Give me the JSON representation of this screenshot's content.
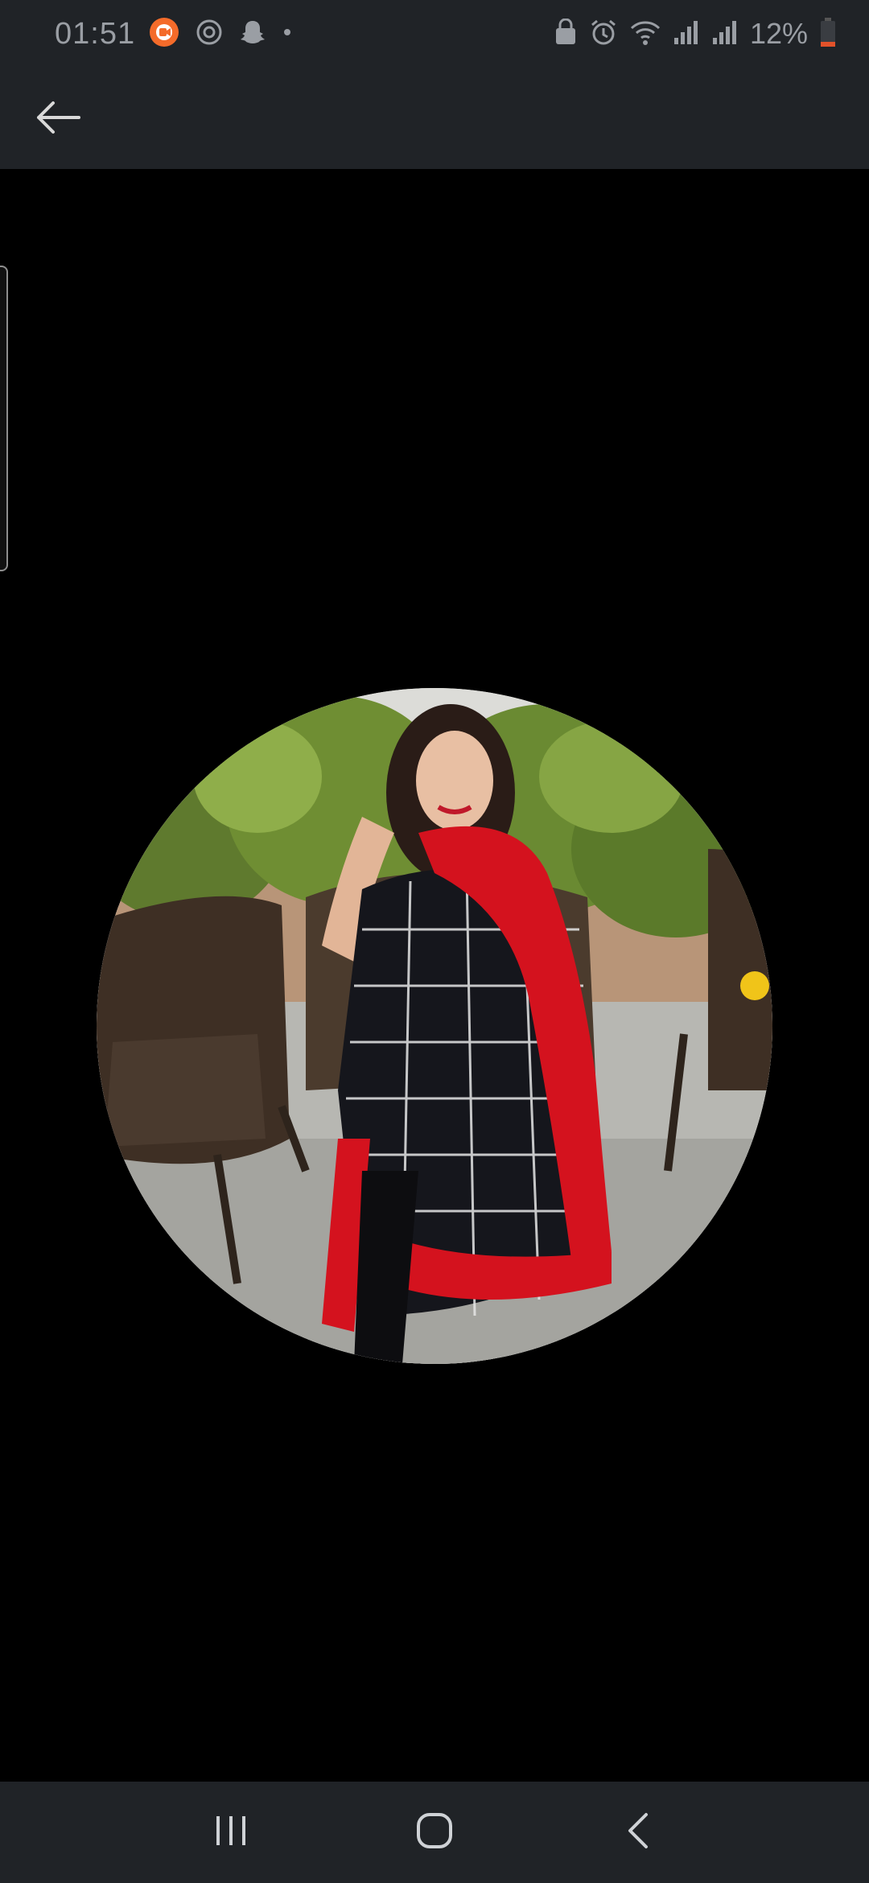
{
  "status_bar": {
    "time": "01:51",
    "battery_percent": "12%",
    "left_icons": [
      "screen-recorder-icon",
      "sync-icon",
      "snapchat-icon",
      "dot-icon"
    ],
    "right_icons": [
      "lock-icon",
      "alarm-icon",
      "wifi-icon",
      "signal-icon",
      "signal-icon",
      "battery-icon"
    ],
    "colors": {
      "recorder": "#f46b2a",
      "battery_low": "#e2522a"
    }
  },
  "app_bar": {
    "back_icon": "arrow-left-icon"
  },
  "viewer": {
    "image": "profile-photo",
    "scroll_indicator": true
  },
  "nav_bar": {
    "buttons": [
      "recent-apps-icon",
      "home-icon",
      "back-chevron-icon"
    ]
  }
}
